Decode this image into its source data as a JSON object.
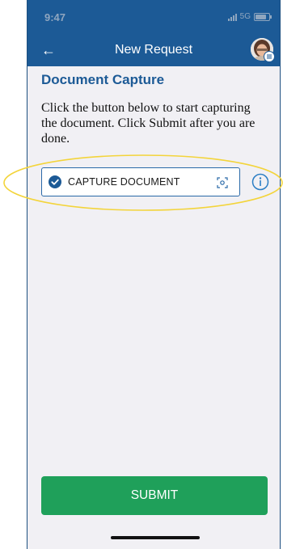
{
  "status_bar": {
    "time": "9:47",
    "network": "5G"
  },
  "app_bar": {
    "title": "New Request"
  },
  "section": {
    "title": "Document Capture",
    "instructions": "Click the button below to start capturing the document. Click Submit after you are done."
  },
  "capture": {
    "label": "CAPTURE DOCUMENT"
  },
  "submit": {
    "label": "SUBMIT"
  },
  "colors": {
    "primary": "#1c5a96",
    "success": "#1fa05a",
    "highlight": "#f3d43a",
    "background": "#f1f0f4"
  },
  "icons": [
    "back-arrow-icon",
    "avatar",
    "checkmark-icon",
    "scan-icon",
    "info-icon"
  ]
}
